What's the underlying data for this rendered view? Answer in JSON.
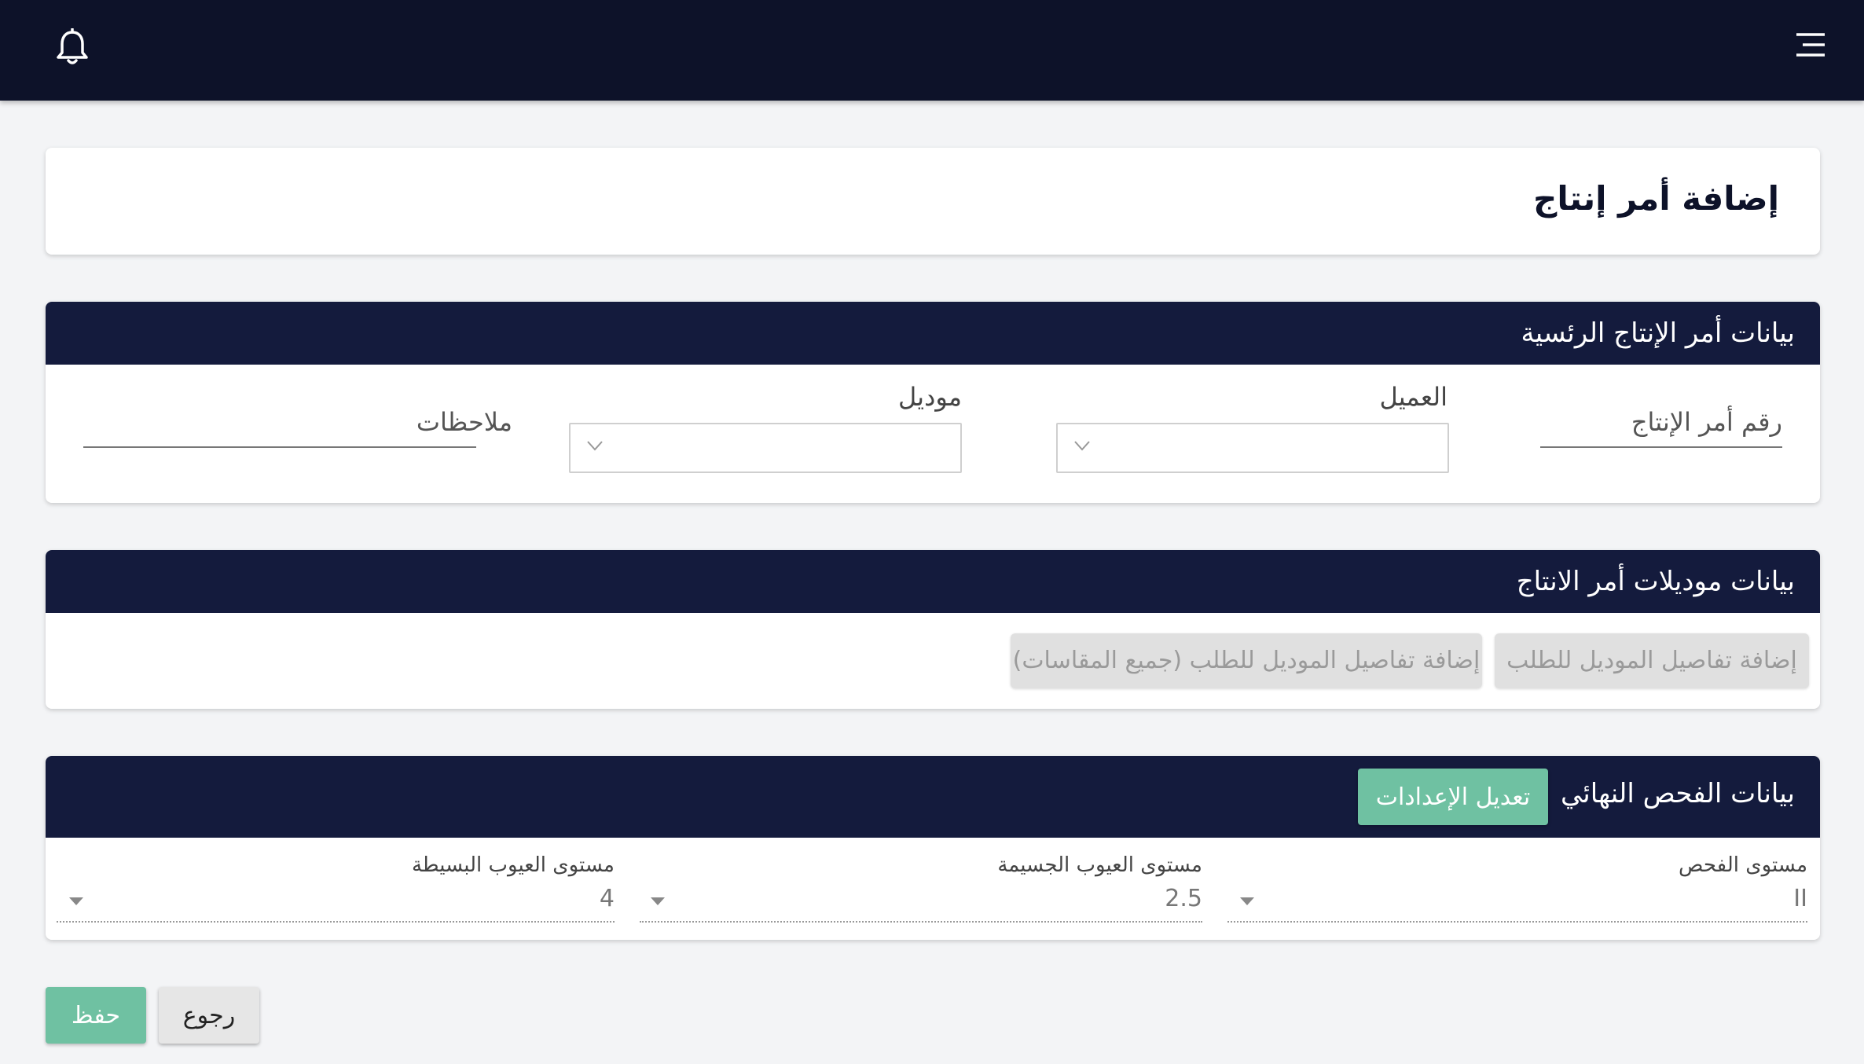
{
  "topbar": {
    "bell_icon": "bell-icon",
    "menu_icon": "hamburger-menu-icon"
  },
  "page": {
    "title": "إضافة أمر إنتاج"
  },
  "main_section": {
    "title": "بيانات أمر الإنتاج الرئسية",
    "order_number_placeholder": "رقم أمر الإنتاج",
    "customer_label": "العميل",
    "customer_value": "",
    "model_label": "موديل",
    "model_value": "",
    "notes_placeholder": "ملاحظات"
  },
  "models_section": {
    "title": "بيانات موديلات أمر الانتاج",
    "add_model_details": "إضافة تفاصيل الموديل للطلب",
    "add_model_details_all_sizes": "إضافة تفاصيل الموديل للطلب (جميع المقاسات)"
  },
  "inspection_section": {
    "title": "بيانات الفحص النهائي",
    "edit_settings": "تعديل الإعدادات",
    "inspection_level_label": "مستوى الفحص",
    "inspection_level_value": "II",
    "major_defects_label": "مستوى العيوب الجسيمة",
    "major_defects_value": "2.5",
    "minor_defects_label": "مستوى العيوب البسيطة",
    "minor_defects_value": "4"
  },
  "actions": {
    "save": "حفظ",
    "back": "رجوع"
  },
  "colors": {
    "topbar": "#0d1229",
    "section_header": "#141b3d",
    "primary_button": "#6fc1a2",
    "background": "#f3f4f6"
  }
}
